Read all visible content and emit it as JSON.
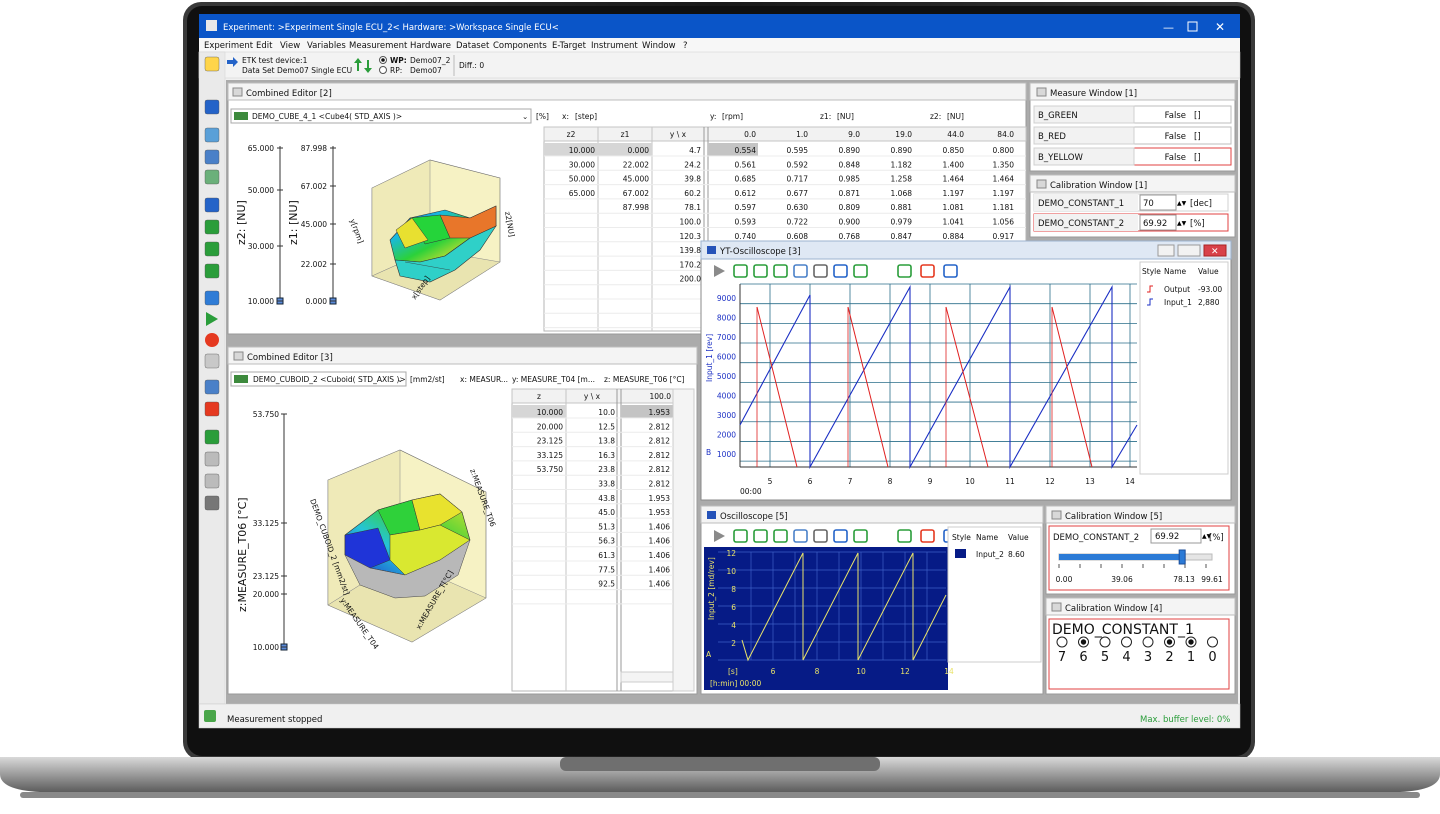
{
  "window": {
    "title": "Experiment: >Experiment Single ECU_2< Hardware: >Workspace Single ECU<"
  },
  "menu": [
    "Experiment",
    "Edit",
    "View",
    "Variables",
    "Measurement",
    "Hardware",
    "Dataset",
    "Components",
    "E-Target",
    "Instrument",
    "Window",
    "?"
  ],
  "toolbar": {
    "device_line1": "ETK test device:1",
    "device_line2": "Data Set Demo07 Single ECU",
    "wp_label": "WP:",
    "wp_value": "Demo07_2",
    "rp_label": "RP:",
    "rp_value": "Demo07",
    "diff": "Diff.: 0"
  },
  "editor2": {
    "title": "Combined Editor [2]",
    "dropdown": "DEMO_CUBE_4_1 <Cube4( STD_AXIS )>",
    "unit": "[%]",
    "x_label": "x:",
    "x_unit": "[step]",
    "y_label": "y:",
    "y_unit": "[rpm]",
    "z1_label": "z1:",
    "z1_unit": "[NU]",
    "z2_label": "z2:",
    "z2_unit": "[NU]",
    "z2_axis_label": "z2: [NU]",
    "z1_axis_label": "z1: [NU]",
    "z2_ticks": [
      "65.000",
      "50.000",
      "30.000",
      "10.000"
    ],
    "z1_ticks": [
      "87.998",
      "67.002",
      "45.000",
      "22.002",
      "0.000"
    ],
    "z2_col_header": "z2",
    "z2_col": [
      "10.000",
      "30.000",
      "50.000",
      "65.000"
    ],
    "z1_col_header": "z1",
    "z1_col": [
      "0.000",
      "22.002",
      "45.000",
      "67.002",
      "87.998"
    ],
    "yx_header": "y \\ x",
    "y_values": [
      "4.7",
      "24.2",
      "39.8",
      "60.2",
      "78.1",
      "100.0",
      "120.3",
      "139.8",
      "170.2",
      "200.0"
    ],
    "x_values": [
      "0.0",
      "1.0",
      "9.0",
      "19.0",
      "44.0",
      "84.0"
    ],
    "rows": [
      [
        "0.554",
        "0.595",
        "0.890",
        "0.890",
        "0.850",
        "0.800"
      ],
      [
        "0.561",
        "0.592",
        "0.848",
        "1.182",
        "1.400",
        "1.350"
      ],
      [
        "0.685",
        "0.717",
        "0.985",
        "1.258",
        "1.464",
        "1.464"
      ],
      [
        "0.612",
        "0.677",
        "0.871",
        "1.068",
        "1.197",
        "1.197"
      ],
      [
        "0.597",
        "0.630",
        "0.809",
        "0.881",
        "1.081",
        "1.181"
      ],
      [
        "0.593",
        "0.722",
        "0.900",
        "0.979",
        "1.041",
        "1.056"
      ],
      [
        "0.740",
        "0.608",
        "0.768",
        "0.847",
        "0.884",
        "0.917"
      ]
    ]
  },
  "measure1": {
    "title": "Measure Window [1]",
    "rows": [
      {
        "name": "B_GREEN",
        "value": "False",
        "unit": "[]"
      },
      {
        "name": "B_RED",
        "value": "False",
        "unit": "[]"
      },
      {
        "name": "B_YELLOW",
        "value": "False",
        "unit": "[]"
      }
    ]
  },
  "cal1": {
    "title": "Calibration Window [1]",
    "rows": [
      {
        "name": "DEMO_CONSTANT_1",
        "value": "70",
        "unit": "[dec]"
      },
      {
        "name": "DEMO_CONSTANT_2",
        "value": "69.92",
        "unit": "[%]"
      }
    ]
  },
  "yt": {
    "title": "YT-Oscilloscope [3]",
    "legend_headers": [
      "Style",
      "Name",
      "Value"
    ],
    "legend": [
      {
        "name": "Output",
        "value": "-93.00",
        "color": "#e02020"
      },
      {
        "name": "Input_1",
        "value": "2,880",
        "color": "#1b2fc4"
      }
    ],
    "y_axis_label": "Input_1 [rev]",
    "y_ticks": [
      "9000",
      "8000",
      "7000",
      "6000",
      "5000",
      "4000",
      "3000",
      "2000",
      "1000"
    ],
    "x_ticks": [
      "5",
      "6",
      "7",
      "8",
      "9",
      "10",
      "11",
      "12",
      "13",
      "14"
    ],
    "b_label": "B",
    "time_label": "00:00"
  },
  "editor3": {
    "title": "Combined Editor [3]",
    "dropdown": "DEMO_CUBOID_2 <Cuboid( STD_AXIS )>",
    "unit": "[mm2/st]",
    "x_label": "x: MEASUR...",
    "y_label": "y: MEASURE_T04 [m...",
    "z_label": "z: MEASURE_T06 [°C]",
    "axis_label": "z:MEASURE_T06 [°C]",
    "ticks": [
      "53.750",
      "33.125",
      "23.125",
      "20.000",
      "10.000"
    ],
    "z_header": "z",
    "z_col": [
      "10.000",
      "20.000",
      "23.125",
      "33.125",
      "53.750"
    ],
    "yx_header": "y \\ x",
    "y_col": [
      "10.0",
      "12.5",
      "13.8",
      "16.3",
      "23.8",
      "33.8",
      "43.8",
      "45.0",
      "51.3",
      "56.3",
      "61.3",
      "77.5",
      "92.5"
    ],
    "v_header": "100.0",
    "v_col": [
      "1.953",
      "2.812",
      "2.812",
      "2.812",
      "2.812",
      "2.812",
      "1.953",
      "1.953",
      "1.406",
      "1.406",
      "1.406",
      "1.406",
      "1.406"
    ]
  },
  "osc5": {
    "title": "Oscilloscope [5]",
    "legend_headers": [
      "Style",
      "Name",
      "Value"
    ],
    "legend": [
      {
        "name": "Input_2",
        "value": "8.60"
      }
    ],
    "y_axis_label": "Input_2 [md/rev]",
    "y_ticks": [
      "12",
      "10",
      "8",
      "6",
      "4",
      "2"
    ],
    "x_ticks": [
      "6",
      "8",
      "10",
      "12",
      "14"
    ],
    "a_label": "A",
    "s_label": "[s]",
    "time_label": "[h:min] 00:00"
  },
  "cal5": {
    "title": "Calibration Window [5]",
    "name": "DEMO_CONSTANT_2",
    "value": "69.92",
    "unit": "[%]",
    "slider_fraction": 0.7,
    "ticks": [
      "0.00",
      "39.06",
      "78.13",
      "99.61"
    ]
  },
  "cal4": {
    "title": "Calibration Window [4]",
    "name": "DEMO_CONSTANT_1",
    "bits": [
      "7",
      "6",
      "5",
      "4",
      "3",
      "2",
      "1",
      "0"
    ],
    "bit_values": [
      0,
      1,
      0,
      0,
      0,
      1,
      1,
      0
    ]
  },
  "status": {
    "left": "Measurement stopped",
    "right": "Max. buffer level: 0%"
  }
}
